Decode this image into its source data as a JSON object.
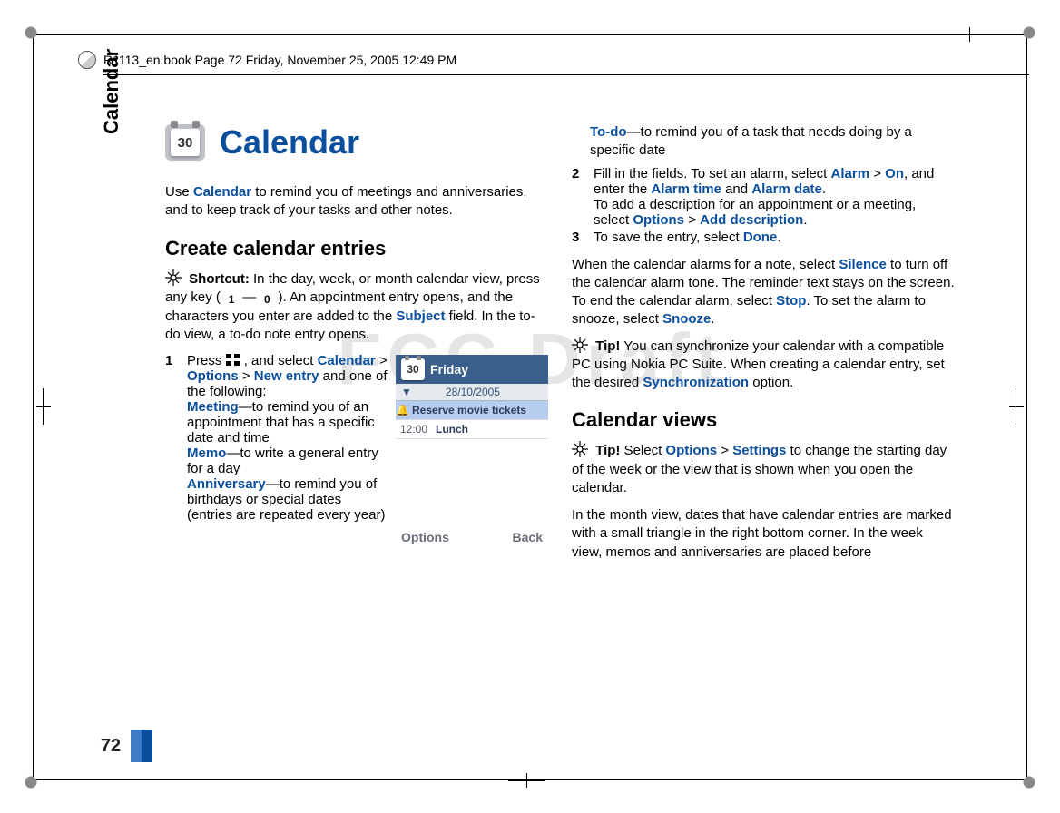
{
  "running_header": "R1113_en.book  Page 72  Friday, November 25, 2005  12:49 PM",
  "side_tab": "Calendar",
  "page_number": "72",
  "watermark": "FCC Draft",
  "title": "Calendar",
  "cal_chip_num": "30",
  "intro": {
    "pre": "Use ",
    "hl": "Calendar",
    "post": " to remind you of meetings and anniversaries, and to keep track of your tasks and other notes."
  },
  "h2_create": "Create calendar entries",
  "shortcut": {
    "label": "Shortcut:",
    "t1": " In the day, week, or month calendar view, press any key (",
    "key1": "1",
    "dash": "—",
    "key2": "0",
    "t2": "). An appointment entry opens, and the characters you enter are added to the ",
    "hl": "Subject",
    "t3": " field. In the to-do view, a to-do note entry opens."
  },
  "step1": {
    "num": "1",
    "a": "Press ",
    "b": ", and select ",
    "calendar": "Calendar",
    "gt1": " > ",
    "options": "Options",
    "gt2": " > ",
    "newentry": "New entry",
    "c": " and one of the following:",
    "meeting": "Meeting",
    "meeting_t": "—to remind you of an appointment that has a specific date and time",
    "memo": "Memo",
    "memo_t": "—to write a general entry for a day",
    "anniv": "Anniversary",
    "anniv_t": "—to remind you of birthdays or special dates (entries are repeated every year)",
    "todo": "To-do",
    "todo_t": "—to remind you of a task that needs doing by a specific date"
  },
  "step2": {
    "num": "2",
    "a": "Fill in the fields. To set an alarm, select ",
    "alarm": "Alarm",
    "gt": " > ",
    "on": "On",
    "b": ", and enter the ",
    "alarmtime": "Alarm time",
    "and": " and ",
    "alarmdate": "Alarm date",
    "c": ".",
    "d": "To add a description for an appointment or a meeting, select ",
    "options": "Options",
    "gt2": " > ",
    "adddesc": "Add description",
    "e": "."
  },
  "step3": {
    "num": "3",
    "a": "To save the entry, select ",
    "done": "Done",
    "b": "."
  },
  "alarm_para": {
    "a": "When the calendar alarms for a note, select ",
    "silence": "Silence",
    "b": " to turn off the calendar alarm tone. The reminder text stays on the screen. To end the calendar alarm, select ",
    "stop": "Stop",
    "c": ". To set the alarm to snooze, select ",
    "snooze": "Snooze",
    "d": "."
  },
  "tip1": {
    "label": "Tip!",
    "a": " You can synchronize your calendar with a compatible PC using Nokia PC Suite. When creating a calendar entry, set the desired ",
    "sync": "Synchronization",
    "b": " option."
  },
  "h2_views": "Calendar views",
  "tip2": {
    "label": "Tip!",
    "a": " Select ",
    "options": "Options",
    "gt": " > ",
    "settings": "Settings",
    "b": " to change the starting day of the week or the view that is shown when you open the calendar."
  },
  "views_para": "In the month view, dates that have calendar entries are marked with a small triangle in the right bottom corner. In the week view, memos and anniversaries are placed before",
  "phone": {
    "mini_num": "30",
    "day": "Friday",
    "signal": "▼",
    "date": "28/10/2005",
    "row1_bell": "🔔",
    "row1_label": "Reserve movie tickets",
    "row2_time": "12:00",
    "row2_label": "Lunch",
    "soft_left": "Options",
    "soft_right": "Back"
  }
}
